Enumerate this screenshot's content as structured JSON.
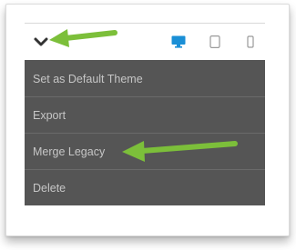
{
  "toolbar": {
    "toggle_icon": "chevron-down-icon",
    "devices": [
      {
        "name": "desktop",
        "icon": "desktop-icon",
        "active": true,
        "color": "#1a8fd6"
      },
      {
        "name": "tablet",
        "icon": "tablet-icon",
        "active": false,
        "color": "#9a9a9a"
      },
      {
        "name": "mobile",
        "icon": "mobile-icon",
        "active": false,
        "color": "#9a9a9a"
      }
    ]
  },
  "menu": {
    "items": [
      {
        "label": "Set as Default Theme"
      },
      {
        "label": "Export"
      },
      {
        "label": "Merge Legacy"
      },
      {
        "label": "Delete"
      }
    ],
    "background": "#555555",
    "text_color": "#c6c6c6"
  },
  "annotations": {
    "arrow_color": "#7cbf3a",
    "arrows": [
      "pointing-to-chevron",
      "pointing-to-merge-legacy"
    ]
  }
}
